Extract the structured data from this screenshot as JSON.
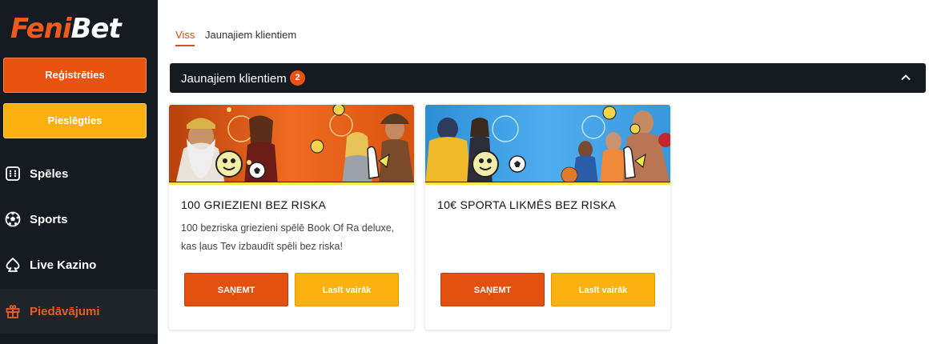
{
  "brand": {
    "logo_left": "Feni",
    "logo_right": "Bet"
  },
  "sidebar": {
    "register_label": "Reģistrēties",
    "login_label": "Pieslēgties",
    "items": [
      {
        "label": "Spēles",
        "icon": "dice-icon"
      },
      {
        "label": "Sports",
        "icon": "soccer-ball-icon"
      },
      {
        "label": "Live Kazino",
        "icon": "spade-icon"
      },
      {
        "label": "Piedāvājumi",
        "icon": "gift-icon",
        "active": true
      }
    ]
  },
  "tabs": [
    {
      "label": "Viss",
      "active": true
    },
    {
      "label": "Jaunajiem klientiem",
      "active": false
    }
  ],
  "section": {
    "title": "Jaunajiem klientiem",
    "count": "2"
  },
  "cards": [
    {
      "title": "100 GRIEZIENI BEZ RISKA",
      "description": "100 bezriska griezieni spēlē Book Of Ra deluxe, kas ļaus Tev izbaudīt spēli bez riska!",
      "claim_label": "SAŅEMT",
      "more_label": "Lasīt vairāk"
    },
    {
      "title": "10€ SPORTA LIKMĒS BEZ RISKA",
      "description": "",
      "claim_label": "SAŅEMT",
      "more_label": "Lasīt vairāk"
    }
  ],
  "colors": {
    "brand_orange": "#e85410",
    "brand_yellow": "#fbb012",
    "sidebar_bg": "#161b22",
    "active_nav": "#ef5a1d"
  }
}
